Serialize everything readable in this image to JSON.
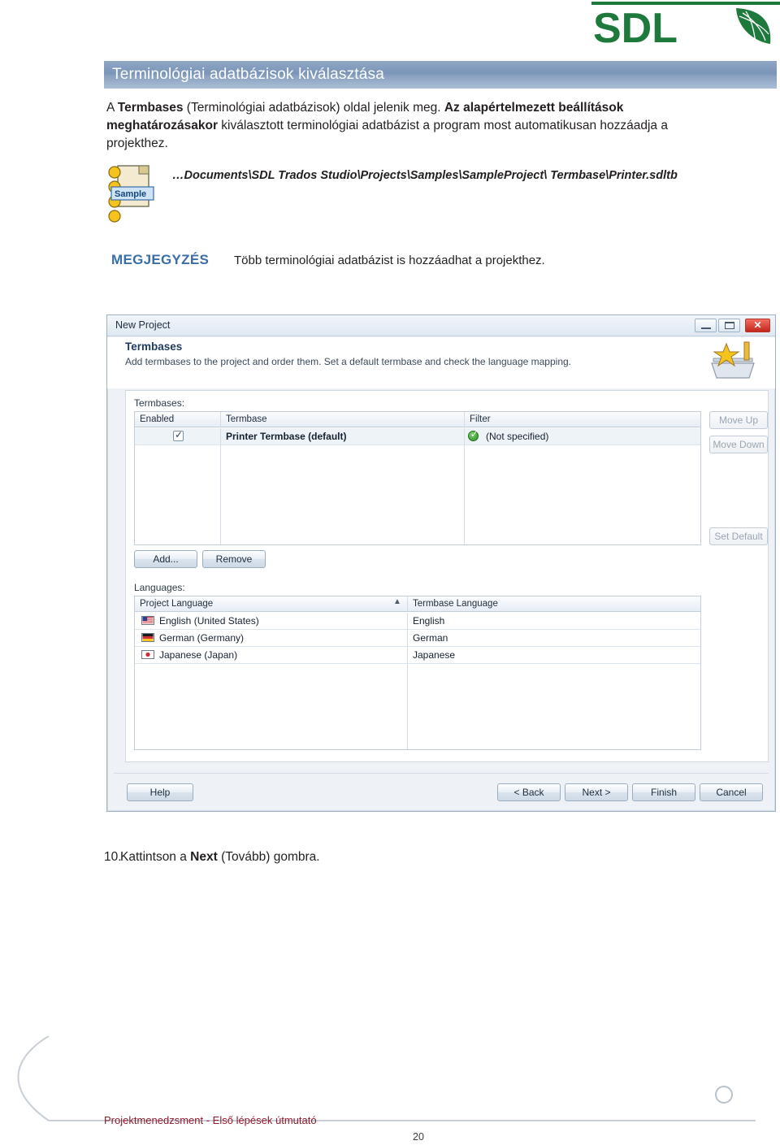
{
  "brand": {
    "name": "SDL",
    "accent": "#1e7a3c",
    "title_bar_color": "#7b95b8"
  },
  "heading": "Terminológiai adatbázisok kiválasztása",
  "paragraph": {
    "prefix": "A ",
    "bold1": "Termbases",
    "mid": " (Terminológiai adatbázisok) oldal jelenik meg. ",
    "bold2": "Az alapértelmezett beállítások meghatározásakor",
    "rest": " kiválasztott terminológiai adatbázist a program most automatikusan hozzáadja a projekthez."
  },
  "sample_icon_label": "Sample",
  "path_line": "…Documents\\SDL Trados Studio\\Projects\\Samples\\SampleProject\\ Termbase\\Printer.sdltb",
  "note": {
    "label": "MEGJEGYZÉS",
    "text": "Több terminológiai adatbázist is hozzáadhat a projekthez."
  },
  "screenshot": {
    "window_title": "New Project",
    "window_buttons": {
      "minimize": "minimize-icon",
      "maximize": "maximize-icon",
      "close": "close-icon"
    },
    "header_title": "Termbases",
    "header_subtitle": "Add termbases to the project and order them. Set a default termbase and check the language mapping.",
    "termbases_group_label": "Termbases:",
    "termbases_columns": [
      "Enabled",
      "Termbase",
      "Filter"
    ],
    "termbases_rows": [
      {
        "enabled": true,
        "termbase": "Printer Termbase (default)",
        "filter": "(Not specified)",
        "filter_status": "ok"
      }
    ],
    "side_buttons": [
      "Move Up",
      "Move Down",
      "Set Default"
    ],
    "list_buttons": [
      "Add...",
      "Remove"
    ],
    "languages_group_label": "Languages:",
    "languages_columns": [
      "Project Language",
      "Termbase Language"
    ],
    "languages_rows": [
      {
        "project": "English (United States)",
        "termbase": "English",
        "flag": "us-flag-icon"
      },
      {
        "project": "German (Germany)",
        "termbase": "German",
        "flag": "de-flag-icon"
      },
      {
        "project": "Japanese (Japan)",
        "termbase": "Japanese",
        "flag": "jp-flag-icon"
      }
    ],
    "sort_indicator": "sort-ascending-icon",
    "footer_buttons": [
      "Help",
      "< Back",
      "Next >",
      "Finish",
      "Cancel"
    ]
  },
  "step": {
    "number": "10.",
    "prefix": "Kattintson a ",
    "bold": "Next",
    "suffix": " (Tovább) gombra."
  },
  "footer": {
    "doc_title": "Projektmenedzsment - Első lépések útmutató",
    "page_number": "20"
  }
}
